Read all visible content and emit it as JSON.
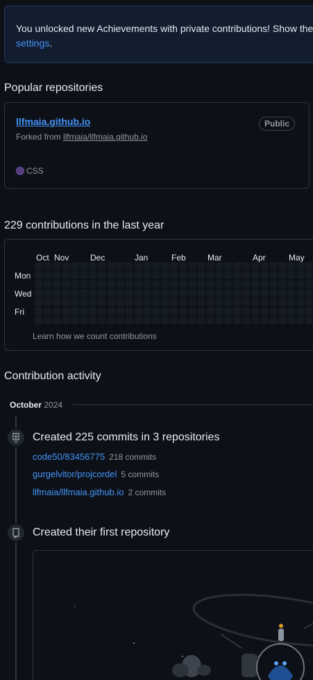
{
  "banner": {
    "text": "You unlocked new Achievements with private contributions! Show them off by including private contributions in your Profile in ",
    "link": "settings",
    "end": "."
  },
  "popular": {
    "title": "Popular repositories",
    "repo": {
      "name": "llfmaia.github.io",
      "visibility": "Public",
      "fork_prefix": "Forked from",
      "fork_source": "llfmaia/llfmaia.github.io",
      "language": "CSS",
      "language_color": "#563d7c"
    }
  },
  "contributions": {
    "title": "229 contributions in the last year",
    "months": [
      "Oct",
      "Nov",
      "Dec",
      "Jan",
      "Feb",
      "Mar",
      "Apr",
      "May"
    ],
    "days": [
      "Mon",
      "Wed",
      "Fri"
    ],
    "learn_link": "Learn how we count contributions"
  },
  "activity": {
    "title": "Contribution activity",
    "month": "October",
    "year": "2024",
    "commits_title": "Created 225 commits in 3 repositories",
    "commit_repos": [
      {
        "name": "code50/83456775",
        "count": "218 commits"
      },
      {
        "name": "gurgelvitor/projcordel",
        "count": "5 commits"
      },
      {
        "name": "llfmaia/llfmaia.github.io",
        "count": "2 commits"
      }
    ],
    "first_repo_title": "Created their first repository"
  }
}
